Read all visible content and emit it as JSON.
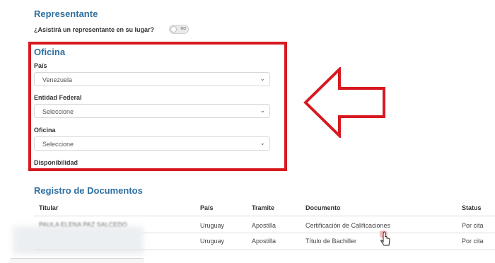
{
  "representante": {
    "title": "Representante",
    "question": "¿Asistirá un representante en su lugar?",
    "toggle_text": "NO"
  },
  "oficina": {
    "title": "Oficina",
    "pais_label": "País",
    "pais_value": "Venezuela",
    "entidad_label": "Entidad Federal",
    "entidad_value": "Seleccione",
    "oficina_label": "Oficina",
    "oficina_value": "Seleccione",
    "disponibilidad_label": "Disponibilidad"
  },
  "registro": {
    "title": "Registro de Documentos",
    "headers": [
      "Titular",
      "País",
      "Tramite",
      "Documento",
      "Status"
    ],
    "rows": [
      {
        "titular": "PAULA ELENA PAZ SALCEDO",
        "pais": "Uruguay",
        "tramite": "Apostilla",
        "documento": "Certificación de Calificaciones",
        "status": "Por cita"
      },
      {
        "titular": "",
        "pais": "Uruguay",
        "tramite": "Apostilla",
        "documento": "Título de Bachiller",
        "status": "Por cita"
      }
    ]
  },
  "colors": {
    "accent": "#2f6f9f",
    "highlight": "#d71920"
  },
  "icons": {
    "select": "chevron-down-icon",
    "pointer": "hand-pointer-icon",
    "callout": "arrow-left-icon"
  }
}
